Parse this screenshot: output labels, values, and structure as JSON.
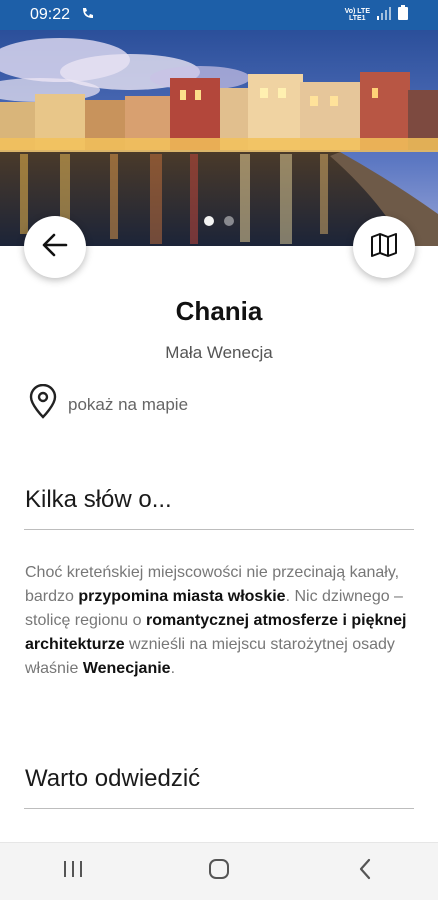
{
  "status_bar": {
    "time": "09:22",
    "carrier_top": "Vo) LTE",
    "carrier_bottom": "LTE1"
  },
  "place": {
    "name": "Chania",
    "subtitle": "Mała Wenecja",
    "map_link": "pokaż na mapie"
  },
  "gallery": {
    "count": 2,
    "active": 1
  },
  "about": {
    "heading": "Kilka słów o...",
    "p1": "Choć kreteńskiej miejscowości nie przecinają kanały, bardzo ",
    "p1_bold": "przypomina miasta włoskie",
    "p2": ". Nic dziwnego – stolicę regionu o ",
    "p2_bold": "romantycznej atmosferze i pięknej architekturze",
    "p3": " wznieśli na miejscu starożytnej osady właśnie ",
    "p3_bold": "Wenecjanie",
    "p4": "."
  },
  "visit": {
    "heading": "Warto odwiedzić"
  },
  "icons": {
    "back": "arrow-left-icon",
    "map": "map-icon",
    "pin": "location-pin-icon",
    "nav_recent": "recent-apps-icon",
    "nav_home": "home-icon",
    "nav_back": "back-chevron-icon"
  },
  "colors": {
    "status_bar": "#1d5fa8",
    "text_primary": "#111111",
    "text_secondary": "#777777"
  }
}
